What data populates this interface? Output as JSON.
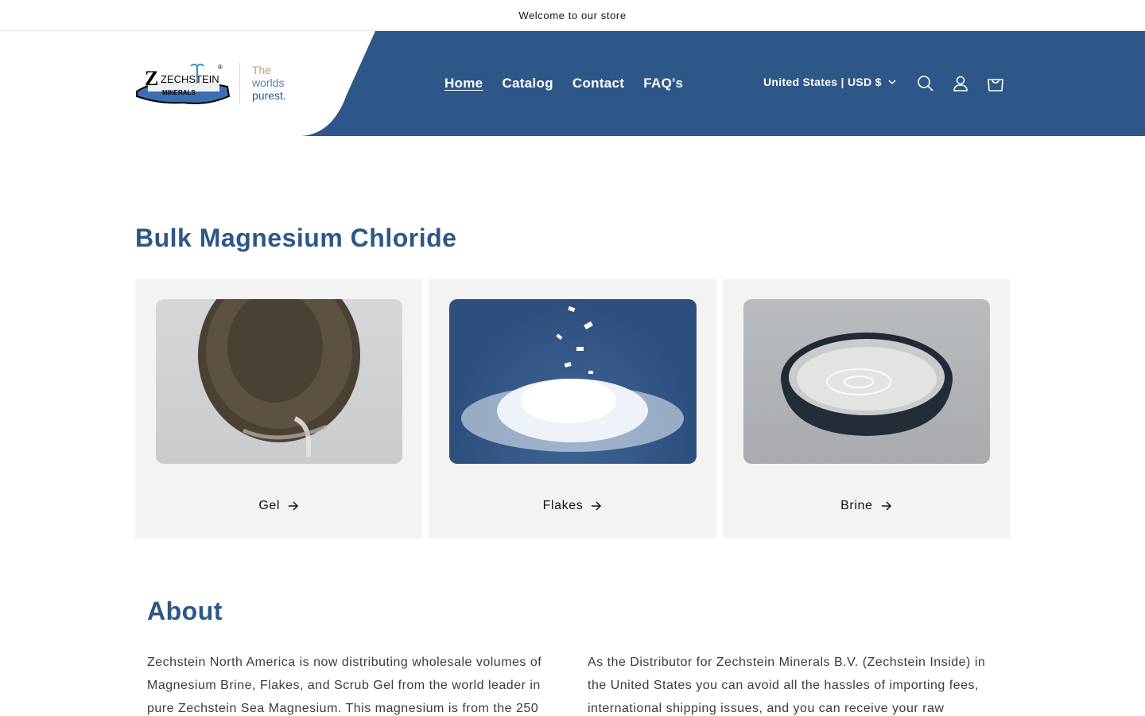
{
  "announcement": {
    "text": "Welcome to our store"
  },
  "header": {
    "logo": {
      "brand_name": "ZECHSTEIN",
      "brand_sub": "MINERALS",
      "registered": "®",
      "tagline_1": "The",
      "tagline_2": "worlds",
      "tagline_3": "purest."
    },
    "nav": [
      {
        "label": "Home",
        "active": true
      },
      {
        "label": "Catalog",
        "active": false
      },
      {
        "label": "Contact",
        "active": false
      },
      {
        "label": "FAQ's",
        "active": false
      }
    ],
    "localization": {
      "label": "United States | USD $"
    },
    "icons": [
      "search-icon",
      "account-icon",
      "cart-icon"
    ],
    "colors": {
      "brand_blue": "#2d5788",
      "white": "#ffffff"
    }
  },
  "collection": {
    "title": "Bulk Magnesium Chloride",
    "cards": [
      {
        "label": "Gel"
      },
      {
        "label": "Flakes"
      },
      {
        "label": "Brine"
      }
    ]
  },
  "about": {
    "title": "About",
    "col1": "Zechstein North America is now distributing wholesale volumes of Magnesium Brine, Flakes, and Scrub Gel from the world leader in pure Zechstein Sea Magnesium. This magnesium is from the 250",
    "col2": "As the Distributor for Zechstein Minerals B.V. (Zechstein Inside) in the United States you can avoid all the hassles of importing fees, international shipping issues, and you can receive your raw"
  }
}
